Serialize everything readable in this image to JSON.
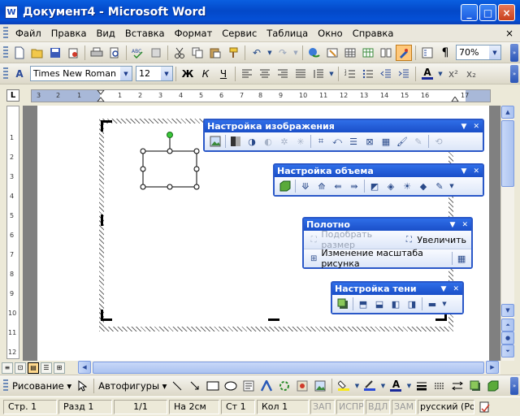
{
  "window": {
    "title": "Документ4 - Microsoft Word",
    "minimize": "_",
    "maximize": "□",
    "close": "×"
  },
  "menu": {
    "items": [
      "Файл",
      "Правка",
      "Вид",
      "Вставка",
      "Формат",
      "Сервис",
      "Таблица",
      "Окно",
      "Справка"
    ],
    "close_glyph": "×"
  },
  "standard_toolbar": {
    "zoom": "70%"
  },
  "formatting_toolbar": {
    "font": "Times New Roman",
    "font_size": "12",
    "bold": "Ж",
    "italic": "К",
    "underline": "Ч"
  },
  "ruler": {
    "horizontal_marks": [
      "3",
      "2",
      "1",
      "1",
      "2",
      "3",
      "4",
      "5",
      "6",
      "7",
      "8",
      "9",
      "10",
      "11",
      "12",
      "13",
      "14",
      "15",
      "16",
      "17"
    ],
    "vertical_marks": [
      "1",
      "2",
      "3",
      "4",
      "5",
      "6",
      "7",
      "8",
      "9",
      "10",
      "11",
      "12"
    ],
    "tab_stop": "L"
  },
  "floating_toolbars": {
    "picture": {
      "title": "Настройка изображения"
    },
    "threed": {
      "title": "Настройка объема"
    },
    "canvas": {
      "title": "Полотно",
      "fit": "Подобрать размер",
      "expand": "Увеличить",
      "scale": "Изменение масштаба рисунка"
    },
    "shadow": {
      "title": "Настройка тени"
    }
  },
  "drawing_toolbar": {
    "draw": "Рисование",
    "autoshapes": "Автофигуры"
  },
  "status": {
    "page": "Стр.  1",
    "section": "Разд  1",
    "pages": "1/1",
    "at": "На  2см",
    "line": "Ст  1",
    "col": "Кол  1",
    "rec": "ЗАП",
    "trk": "ИСПР",
    "ext": "ВДЛ",
    "ovr": "ЗАМ",
    "language": "русский (Ро"
  }
}
